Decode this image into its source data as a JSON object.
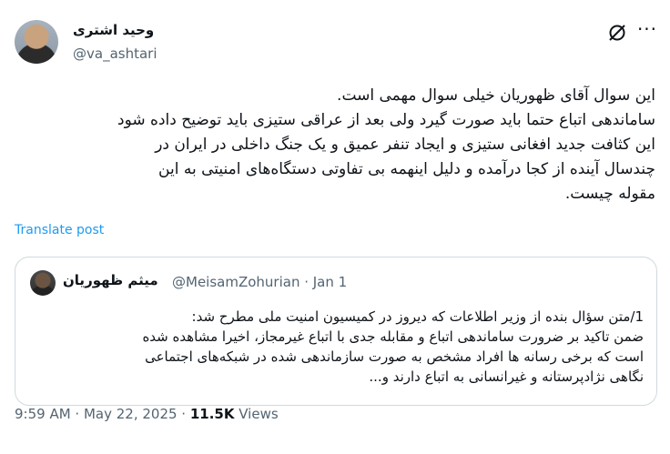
{
  "author": {
    "display_name": "وحید اشتری",
    "handle": "@va_ashtari"
  },
  "actions": {
    "grok_icon": "grok-icon",
    "more_icon": "more-icon",
    "more_label": "···"
  },
  "tweet": {
    "lines": [
      "این سوال آقای ظهوریان خیلی سوال مهمی است.",
      "ساماندهی اتباع حتما باید صورت گیرد ولی بعد از عراقی ستیزی باید توضیح داده شود",
      "این کثافت جدید افغانی ستیزی و ایجاد تنفر عمیق و یک جنگ داخلی در ایران در",
      "چندسال آینده از کجا درآمده و دلیل اینهمه بی تفاوتی دستگاه‌های امنیتی به این",
      "مقوله چیست."
    ],
    "translate_label": "Translate post"
  },
  "quote": {
    "display_name": "میثم ظهوریان",
    "meta": "@MeisamZohurian · Jan 1",
    "lines": [
      "1/متن سؤال بنده از وزیر اطلاعات که دیروز در کمیسیون امنیت ملی مطرح شد:",
      "ضمن تاکید بر ضرورت ساماندهی اتباع و مقابله جدی با اتباع غیرمجاز، اخیرا مشاهده شده",
      "است که برخی رسانه ها افراد مشخص به صورت سازماندهی شده در شبکه‌های اجتماعی",
      "نگاهی نژادپرستانه و غیرانسانی به اتباع دارند و..."
    ]
  },
  "footer": {
    "timestamp": "9:59 AM · May 22, 2025 · ",
    "views_count": "11.5K",
    "views_label": " Views"
  }
}
